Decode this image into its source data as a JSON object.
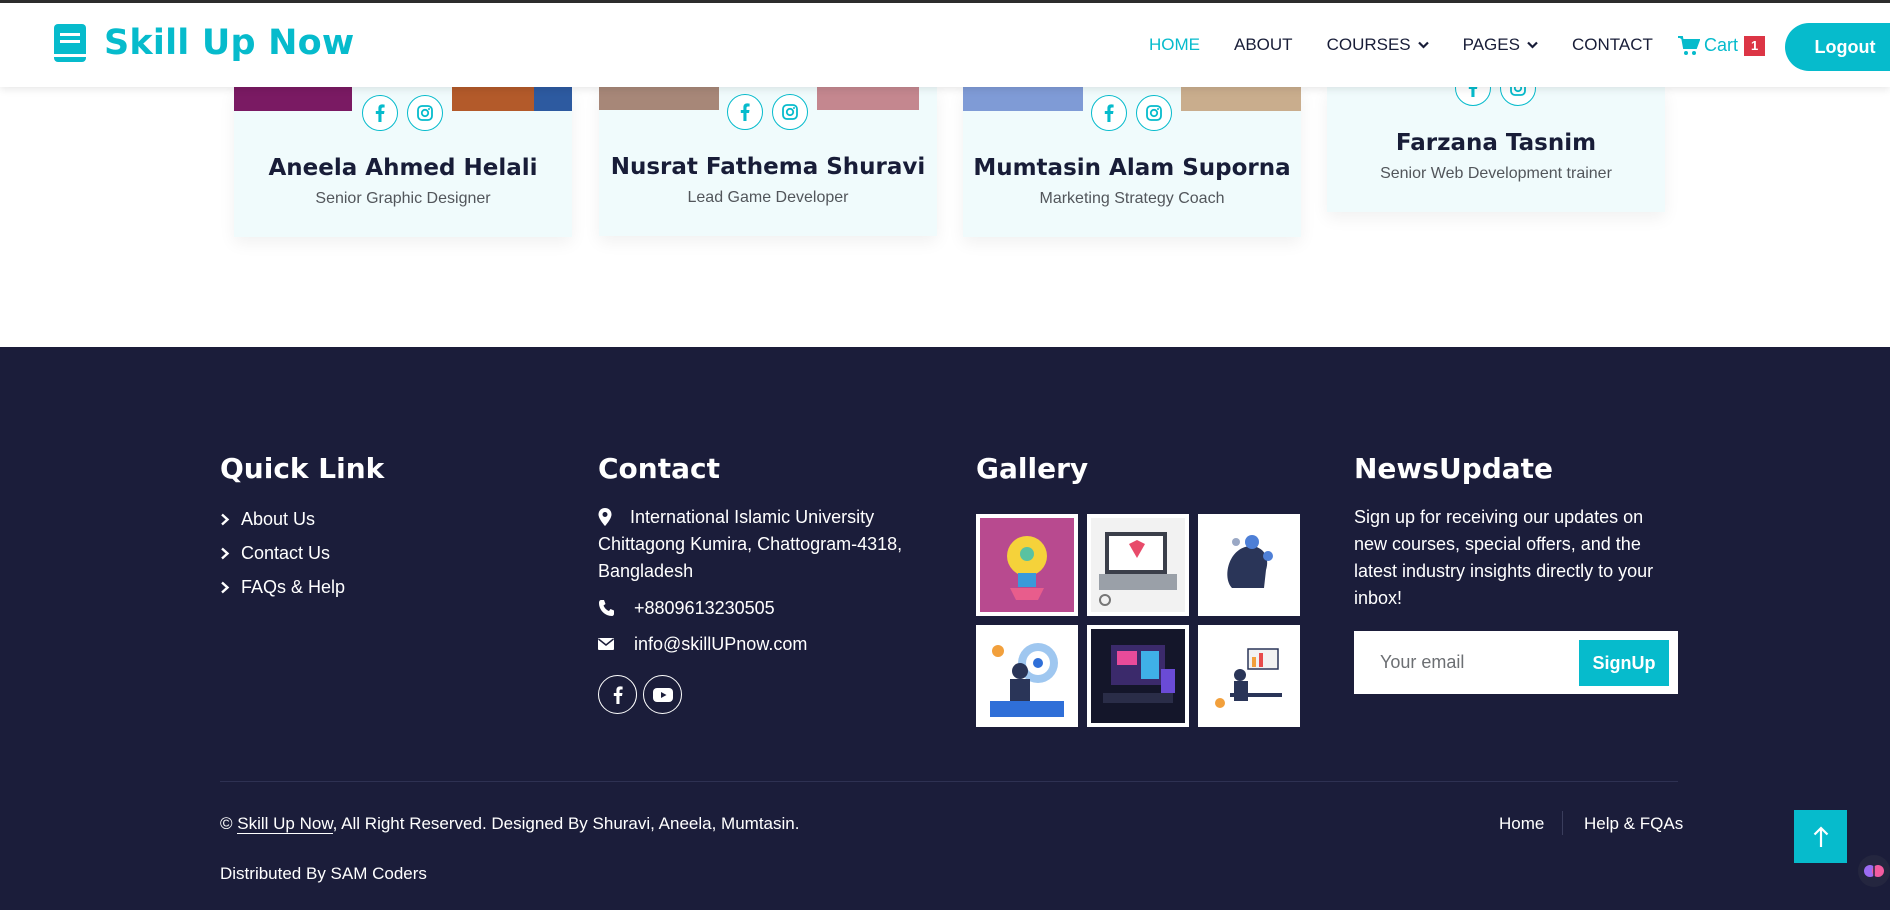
{
  "header": {
    "brand": "Skill Up Now",
    "nav": [
      {
        "label": "HOME",
        "active": true
      },
      {
        "label": "ABOUT"
      },
      {
        "label": "COURSES",
        "dropdown": true
      },
      {
        "label": "PAGES",
        "dropdown": true
      },
      {
        "label": "CONTACT"
      }
    ],
    "cart_label": "Cart",
    "cart_count": "1",
    "logout_label": "Logout"
  },
  "team": [
    {
      "name": "Aneela Ahmed Helali",
      "role": "Senior Graphic Designer"
    },
    {
      "name": "Nusrat Fathema Shuravi",
      "role": "Lead Game Developer"
    },
    {
      "name": "Mumtasin Alam Suporna",
      "role": "Marketing Strategy Coach"
    },
    {
      "name": "Farzana Tasnim",
      "role": "Senior Web Development trainer"
    }
  ],
  "footer": {
    "quick_link_title": "Quick Link",
    "quick_links": [
      "About Us",
      "Contact Us",
      "FAQs & Help"
    ],
    "contact_title": "Contact",
    "address": "International Islamic University Chittagong Kumira, Chattogram-4318, Bangladesh",
    "phone": "+8809613230505",
    "email": "info@skillUPnow.com",
    "gallery_title": "Gallery",
    "news_title": "NewsUpdate",
    "news_text": "Sign up for receiving our updates on new courses, special offers, and the latest industry insights directly to your inbox!",
    "email_placeholder": "Your email",
    "signup_label": "SignUp",
    "copyright_prefix": "© ",
    "copyright_link": "Skill Up Now",
    "copyright_suffix": ", All Right Reserved. Designed By Shuravi, Aneela, Mumtasin.",
    "distributed": "Distributed By SAM Coders",
    "footer_nav": [
      "Home",
      "Help & FQAs"
    ]
  },
  "colors": {
    "accent": "#06bbcc",
    "footer_bg": "#1b1d3a",
    "badge": "#dc3545"
  }
}
